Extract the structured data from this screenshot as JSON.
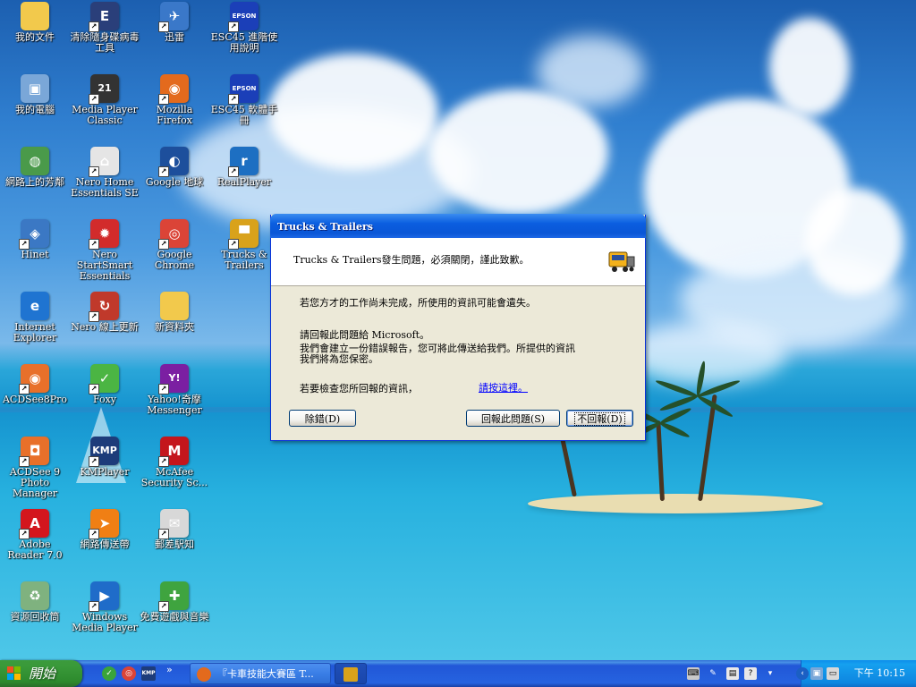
{
  "desktop_icons": [
    {
      "label": "我的文件",
      "icon": "folder-documents-icon",
      "color": "#f2c94c",
      "glyph": "",
      "col": 0,
      "row": 0,
      "shortcut": false
    },
    {
      "label": "清除隨身碟病毒工具",
      "icon": "usb-cleaner-icon",
      "color": "#2a3f7a",
      "glyph": "E",
      "col": 1,
      "row": 0,
      "shortcut": true
    },
    {
      "label": "迅雷",
      "icon": "thunder-icon",
      "color": "#3a78c9",
      "glyph": "✈",
      "col": 2,
      "row": 0,
      "shortcut": true
    },
    {
      "label": "ESC45 進階使用說明",
      "icon": "epson-book-icon",
      "color": "#1b3fb8",
      "glyph": "EPSON",
      "col": 3,
      "row": 0,
      "shortcut": true
    },
    {
      "label": "我的電腦",
      "icon": "my-computer-icon",
      "color": "#7aa7d8",
      "glyph": "▣",
      "col": 0,
      "row": 1,
      "shortcut": false
    },
    {
      "label": "Media Player Classic",
      "icon": "media-player-classic-icon",
      "color": "#333333",
      "glyph": "21",
      "col": 1,
      "row": 1,
      "shortcut": true
    },
    {
      "label": "Mozilla Firefox",
      "icon": "firefox-icon",
      "color": "#e36a1d",
      "glyph": "◉",
      "col": 2,
      "row": 1,
      "shortcut": true
    },
    {
      "label": "ESC45 軟體手冊",
      "icon": "epson-book-icon",
      "color": "#1b3fb8",
      "glyph": "EPSON",
      "col": 3,
      "row": 1,
      "shortcut": true
    },
    {
      "label": "網路上的芳鄰",
      "icon": "network-places-icon",
      "color": "#4a9a4a",
      "glyph": "◍",
      "col": 0,
      "row": 2,
      "shortcut": false
    },
    {
      "label": "Nero Home Essentials SE",
      "icon": "nero-home-icon",
      "color": "#e5e5e5",
      "glyph": "⌂",
      "col": 1,
      "row": 2,
      "shortcut": true
    },
    {
      "label": "Google 地球",
      "icon": "google-earth-icon",
      "color": "#1d4f9c",
      "glyph": "◐",
      "col": 2,
      "row": 2,
      "shortcut": true
    },
    {
      "label": "RealPlayer",
      "icon": "realplayer-icon",
      "color": "#1d6fc2",
      "glyph": "r",
      "col": 3,
      "row": 2,
      "shortcut": true
    },
    {
      "label": "Hinet",
      "icon": "hinet-icon",
      "color": "#3b78c4",
      "glyph": "◈",
      "col": 0,
      "row": 3,
      "shortcut": true
    },
    {
      "label": "Nero StartSmart Essentials",
      "icon": "nero-startsmart-icon",
      "color": "#d22b2b",
      "glyph": "✹",
      "col": 1,
      "row": 3,
      "shortcut": true
    },
    {
      "label": "Google Chrome",
      "icon": "chrome-icon",
      "color": "#db4437",
      "glyph": "◎",
      "col": 2,
      "row": 3,
      "shortcut": true
    },
    {
      "label": "Trucks & Trailers",
      "icon": "truck-icon",
      "color": "#d9a21b",
      "glyph": "▀",
      "col": 3,
      "row": 3,
      "shortcut": true
    },
    {
      "label": "Internet Explorer",
      "icon": "internet-explorer-icon",
      "color": "#1f74d1",
      "glyph": "e",
      "col": 0,
      "row": 4,
      "shortcut": false
    },
    {
      "label": "Nero 線上更新",
      "icon": "nero-update-icon",
      "color": "#c0392b",
      "glyph": "↻",
      "col": 1,
      "row": 4,
      "shortcut": true
    },
    {
      "label": "新資料夾",
      "icon": "folder-icon",
      "color": "#f2c94c",
      "glyph": "",
      "col": 2,
      "row": 4,
      "shortcut": false
    },
    {
      "label": "ACDSee8Pro",
      "icon": "acdsee-icon",
      "color": "#e8702a",
      "glyph": "◉",
      "col": 0,
      "row": 5,
      "shortcut": true
    },
    {
      "label": "Foxy",
      "icon": "foxy-icon",
      "color": "#4bb543",
      "glyph": "✓",
      "col": 1,
      "row": 5,
      "shortcut": true
    },
    {
      "label": "Yahoo!奇摩 Messenger",
      "icon": "yahoo-messenger-icon",
      "color": "#7b1fa2",
      "glyph": "Y!",
      "col": 2,
      "row": 5,
      "shortcut": true
    },
    {
      "label": "ACDSee 9 Photo Manager",
      "icon": "acdsee-camera-icon",
      "color": "#e8702a",
      "glyph": "◘",
      "col": 0,
      "row": 6,
      "shortcut": true
    },
    {
      "label": "KMPlayer",
      "icon": "kmplayer-icon",
      "color": "#1d3c7a",
      "glyph": "KMP",
      "col": 1,
      "row": 6,
      "shortcut": true
    },
    {
      "label": "McAfee Security Sc...",
      "icon": "mcafee-icon",
      "color": "#c4161c",
      "glyph": "M",
      "col": 2,
      "row": 6,
      "shortcut": true
    },
    {
      "label": "Adobe Reader 7.0",
      "icon": "adobe-reader-icon",
      "color": "#d3161d",
      "glyph": "A",
      "col": 0,
      "row": 7,
      "shortcut": true
    },
    {
      "label": "網路傳送帶",
      "icon": "flashget-icon",
      "color": "#f07f14",
      "glyph": "➤",
      "col": 1,
      "row": 7,
      "shortcut": true
    },
    {
      "label": "郵差駅知",
      "icon": "mail-notifier-icon",
      "color": "#d8d8d8",
      "glyph": "✉",
      "col": 2,
      "row": 7,
      "shortcut": true
    },
    {
      "label": "資源回收筒",
      "icon": "recycle-bin-icon",
      "color": "#7fb27f",
      "glyph": "♻",
      "col": 0,
      "row": 8,
      "shortcut": false
    },
    {
      "label": "Windows Media Player",
      "icon": "windows-media-player-icon",
      "color": "#1f6cc9",
      "glyph": "▶",
      "col": 1,
      "row": 8,
      "shortcut": true
    },
    {
      "label": "免費遊戲與音樂",
      "icon": "gift-box-icon",
      "color": "#3fa43f",
      "glyph": "✚",
      "col": 2,
      "row": 8,
      "shortcut": true
    }
  ],
  "dialog": {
    "title": "Trucks & Trailers",
    "header_message": "Trucks & Trailers發生問題，必須關閉，謹此致歉。",
    "line1": "若您方才的工作尚未完成，所使用的資訊可能會遺失。",
    "line2": "請回報此問題給 Microsoft。",
    "line3": "我們會建立一份錯誤報告，您可將此傳送給我們。所提供的資訊",
    "line4": "我們將為您保密。",
    "line5": "若要檢查您所回報的資訊，",
    "link": "請按這裡。",
    "debug_button": "除錯(D)",
    "send_button": "回報此問題(S)",
    "dont_send_button": "不回報(D)"
  },
  "taskbar": {
    "start_label": "開始",
    "task1_label": "『卡車技能大賽區 T...",
    "clock": "下午 10:15",
    "more_chevron": "»"
  },
  "colors": {
    "taskbar_blue": "#245edb",
    "start_green": "#3a9a3a",
    "dialog_title_blue": "#0a56d6",
    "link_blue": "#0000ff"
  }
}
